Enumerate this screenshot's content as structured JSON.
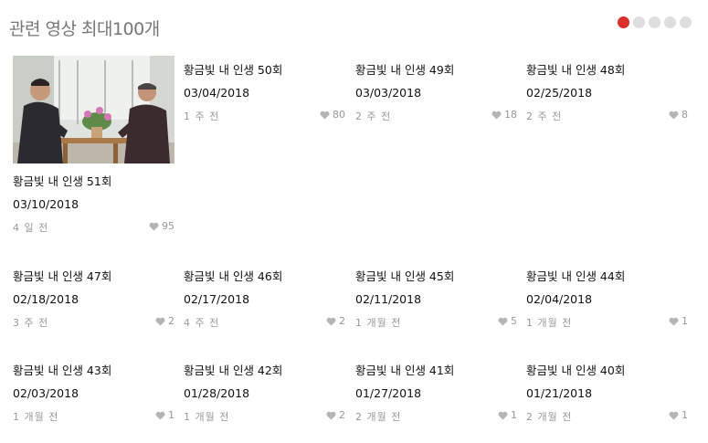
{
  "header": {
    "title": "관련 영상 최대100개",
    "page_count": 5,
    "active_page": 1
  },
  "colors": {
    "accent": "#d9302a",
    "dot_inactive": "#dedede",
    "muted_text": "#999999"
  },
  "videos": [
    {
      "title": "황금빛 내 인생 51회",
      "date": "03/10/2018",
      "ago": "4 일 전",
      "likes": "95",
      "has_thumbnail": true
    },
    {
      "title": "황금빛 내 인생 50회",
      "date": "03/04/2018",
      "ago": "1 주 전",
      "likes": "80"
    },
    {
      "title": "황금빛 내 인생 49회",
      "date": "03/03/2018",
      "ago": "2 주 전",
      "likes": "18"
    },
    {
      "title": "황금빛 내 인생 48회",
      "date": "02/25/2018",
      "ago": "2 주 전",
      "likes": "8"
    },
    {
      "title": "황금빛 내 인생 47회",
      "date": "02/18/2018",
      "ago": "3 주 전",
      "likes": "2"
    },
    {
      "title": "황금빛 내 인생 46회",
      "date": "02/17/2018",
      "ago": "4 주 전",
      "likes": "2"
    },
    {
      "title": "황금빛 내 인생 45회",
      "date": "02/11/2018",
      "ago": "1 개월 전",
      "likes": "5"
    },
    {
      "title": "황금빛 내 인생 44회",
      "date": "02/04/2018",
      "ago": "1 개월 전",
      "likes": "1"
    },
    {
      "title": "황금빛 내 인생 43회",
      "date": "02/03/2018",
      "ago": "1 개월 전",
      "likes": "1"
    },
    {
      "title": "황금빛 내 인생 42회",
      "date": "01/28/2018",
      "ago": "1 개월 전",
      "likes": "2"
    },
    {
      "title": "황금빛 내 인생 41회",
      "date": "01/27/2018",
      "ago": "2 개월 전",
      "likes": "1"
    },
    {
      "title": "황금빛 내 인생 40회",
      "date": "01/21/2018",
      "ago": "2 개월 전",
      "likes": "1"
    }
  ],
  "icons": {
    "like": "heart-icon"
  }
}
